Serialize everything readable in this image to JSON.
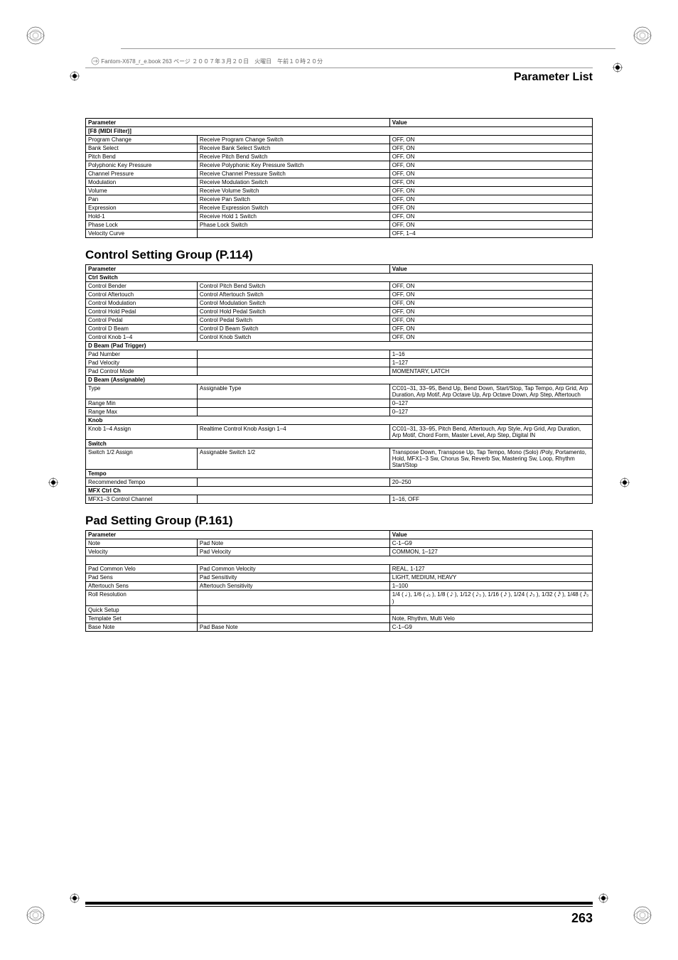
{
  "book_header": "Fantom-X678_r_e.book 263 ページ ２００７年３月２０日　火曜日　午前１０時２０分",
  "section_title": "Parameter List",
  "page_number": "263",
  "table_labels": {
    "parameter": "Parameter",
    "value": "Value"
  },
  "midi_filter": {
    "header": "[F8 (MIDI Filter)]",
    "rows": [
      {
        "p": "Program Change",
        "d": "Receive Program Change Switch",
        "v": "OFF, ON"
      },
      {
        "p": "Bank Select",
        "d": "Receive Bank Select Switch",
        "v": "OFF, ON"
      },
      {
        "p": "Pitch Bend",
        "d": "Receive Pitch Bend Switch",
        "v": "OFF, ON"
      },
      {
        "p": "Polyphonic Key Pressure",
        "d": "Receive Polyphonic Key Pressure Switch",
        "v": "OFF, ON"
      },
      {
        "p": "Channel Pressure",
        "d": "Receive Channel Pressure Switch",
        "v": "OFF, ON"
      },
      {
        "p": "Modulation",
        "d": "Receive Modulation Switch",
        "v": "OFF, ON"
      },
      {
        "p": "Volume",
        "d": "Receive Volume Switch",
        "v": "OFF, ON"
      },
      {
        "p": "Pan",
        "d": "Receive Pan Switch",
        "v": "OFF, ON"
      },
      {
        "p": "Expression",
        "d": "Receive Expression Switch",
        "v": "OFF, ON"
      },
      {
        "p": "Hold-1",
        "d": "Receive Hold 1 Switch",
        "v": "OFF, ON"
      },
      {
        "p": "Phase Lock",
        "d": "Phase Lock Switch",
        "v": "OFF, ON"
      },
      {
        "p": "Velocity Curve",
        "d": "",
        "v": "OFF, 1–4"
      }
    ]
  },
  "control_setting": {
    "title": "Control Setting Group (P.114)",
    "ctrl_switch": "Ctrl Switch",
    "rows1": [
      {
        "p": "Control Bender",
        "d": "Control Pitch Bend Switch",
        "v": "OFF, ON"
      },
      {
        "p": "Control Aftertouch",
        "d": "Control Aftertouch Switch",
        "v": "OFF, ON"
      },
      {
        "p": "Control Modulation",
        "d": "Control Modulation Switch",
        "v": "OFF, ON"
      },
      {
        "p": "Control Hold Pedal",
        "d": "Control Hold Pedal Switch",
        "v": "OFF, ON"
      },
      {
        "p": "Control Pedal",
        "d": "Control Pedal Switch",
        "v": "OFF, ON"
      },
      {
        "p": "Control D Beam",
        "d": "Control D Beam Switch",
        "v": "OFF, ON"
      },
      {
        "p": "Control Knob 1–4",
        "d": "Control Knob Switch",
        "v": "OFF, ON"
      }
    ],
    "dbeam_pad": "D Beam (Pad Trigger)",
    "rows2": [
      {
        "p": "Pad Number",
        "d": "",
        "v": "1–16"
      },
      {
        "p": "Pad Velocity",
        "d": "",
        "v": "1–127"
      },
      {
        "p": "Pad Control Mode",
        "d": "",
        "v": "MOMENTARY, LATCH"
      }
    ],
    "dbeam_assign": "D Beam (Assignable)",
    "rows3": [
      {
        "p": "Type",
        "d": "Assignable Type",
        "v": "CC01–31, 33–95, Bend Up, Bend Down, Start/Stop, Tap Tempo, Arp Grid, Arp Duration, Arp Motif, Arp Octave Up, Arp Octave Down, Arp Step, Aftertouch"
      },
      {
        "p": "Range Min",
        "d": "",
        "v": "0–127"
      },
      {
        "p": "Range Max",
        "d": "",
        "v": "0–127"
      }
    ],
    "knob": "Knob",
    "rows4": [
      {
        "p": "Knob 1–4 Assign",
        "d": "Realtime Control Knob Assign 1–4",
        "v": "CC01–31, 33–95, Pitch Bend, Aftertouch, Arp Style, Arp Grid, Arp Duration, Arp Motif, Chord Form, Master Level, Arp Step, Digital IN"
      }
    ],
    "switch": "Switch",
    "rows5": [
      {
        "p": "Switch 1/2 Assign",
        "d": "Assignable Switch 1/2",
        "v": "Transpose Down, Transpose Up, Tap Tempo, Mono (Solo) /Poly, Portamento, Hold, MFX1–3 Sw, Chorus Sw, Reverb Sw, Mastering Sw, Loop, Rhythm Start/Stop"
      }
    ],
    "tempo": "Tempo",
    "rows6": [
      {
        "p": "Recommended Tempo",
        "d": "",
        "v": "20–250"
      }
    ],
    "mfx": "MFX Ctrl Ch",
    "rows7": [
      {
        "p": "MFX1–3 Control Channel",
        "d": "",
        "v": "1–16, OFF"
      }
    ]
  },
  "pad_setting": {
    "title": "Pad Setting Group (P.161)",
    "rows1": [
      {
        "p": "Note",
        "d": "Pad Note",
        "v": "C-1–G9"
      },
      {
        "p": "Velocity",
        "d": "Pad Velocity",
        "v": "COMMON, 1–127"
      }
    ],
    "blank_row": true,
    "rows2": [
      {
        "p": "Pad Common Velo",
        "d": "Pad Common Velocity",
        "v": "REAL, 1-127"
      },
      {
        "p": "Pad Sens",
        "d": "Pad Sensitivity",
        "v": "LIGHT, MEDIUM, HEAVY"
      },
      {
        "p": "Aftertouch Sens",
        "d": "Aftertouch Sensitivity",
        "v": "1–100"
      },
      {
        "p": "Roll Resolution",
        "d": "",
        "v": "1/4 ( 𝅘𝅥 ), 1/6 ( 𝅘𝅥₃ ), 1/8 ( 𝅘𝅥𝅮 ), 1/12 ( 𝅘𝅥𝅮₃ ), 1/16 ( 𝅘𝅥𝅯 ), 1/24 ( 𝅘𝅥𝅯₃ ), 1/32 ( 𝅘𝅥𝅰 ), 1/48 ( 𝅘𝅥𝅰₃ )"
      },
      {
        "p": "Quick Setup",
        "d": "",
        "v": ""
      },
      {
        "p": "Template Set",
        "d": "",
        "v": "Note, Rhythm, Multi Velo"
      },
      {
        "p": "Base Note",
        "d": "Pad Base Note",
        "v": "C-1–G9"
      }
    ]
  }
}
